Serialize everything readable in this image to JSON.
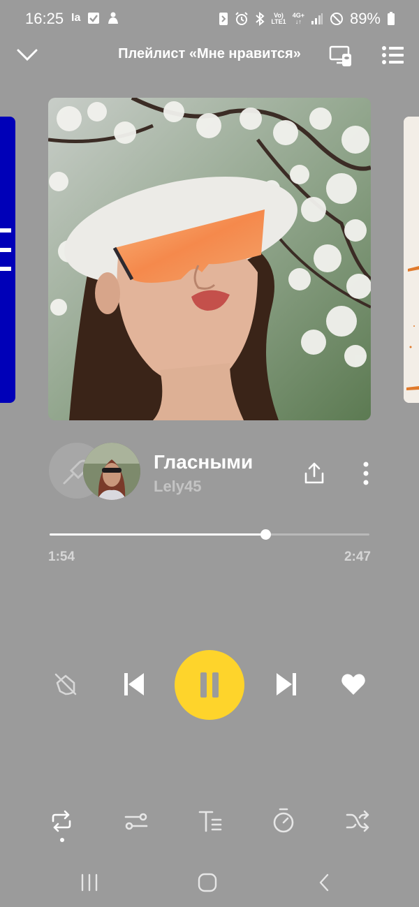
{
  "status_bar": {
    "time": "16:25",
    "left_icons": [
      "instagram-icon",
      "checkbox-icon",
      "app-notification-icon"
    ],
    "right_icons": [
      "nfc-icon",
      "alarm-icon",
      "bluetooth-icon",
      "volte-icon",
      "4g-data-icon",
      "signal-icon",
      "dnd-icon",
      "battery-icon"
    ],
    "network_top": "Vo)",
    "network_bottom": "LTE1",
    "data_top": "4G+",
    "data_bottom": "↓↑",
    "battery": "89%",
    "ig_label": "Ia"
  },
  "header": {
    "title": "Плейлист «Мне нравится»"
  },
  "track": {
    "title": "Гласными",
    "artist": "Lely45"
  },
  "progress": {
    "current": "1:54",
    "total": "2:47",
    "fraction": 0.676
  },
  "colors": {
    "background": "#9b9b9b",
    "play_button": "#fed42b",
    "left_cover": "#0000b8"
  },
  "controls": [
    "dislike-icon",
    "previous-icon",
    "pause-icon",
    "next-icon",
    "like-icon"
  ],
  "bottom_tools": [
    "repeat-icon",
    "equalizer-icon",
    "lyrics-icon",
    "timer-icon",
    "shuffle-icon"
  ],
  "nav": [
    "recent-apps-icon",
    "home-icon",
    "back-icon"
  ]
}
